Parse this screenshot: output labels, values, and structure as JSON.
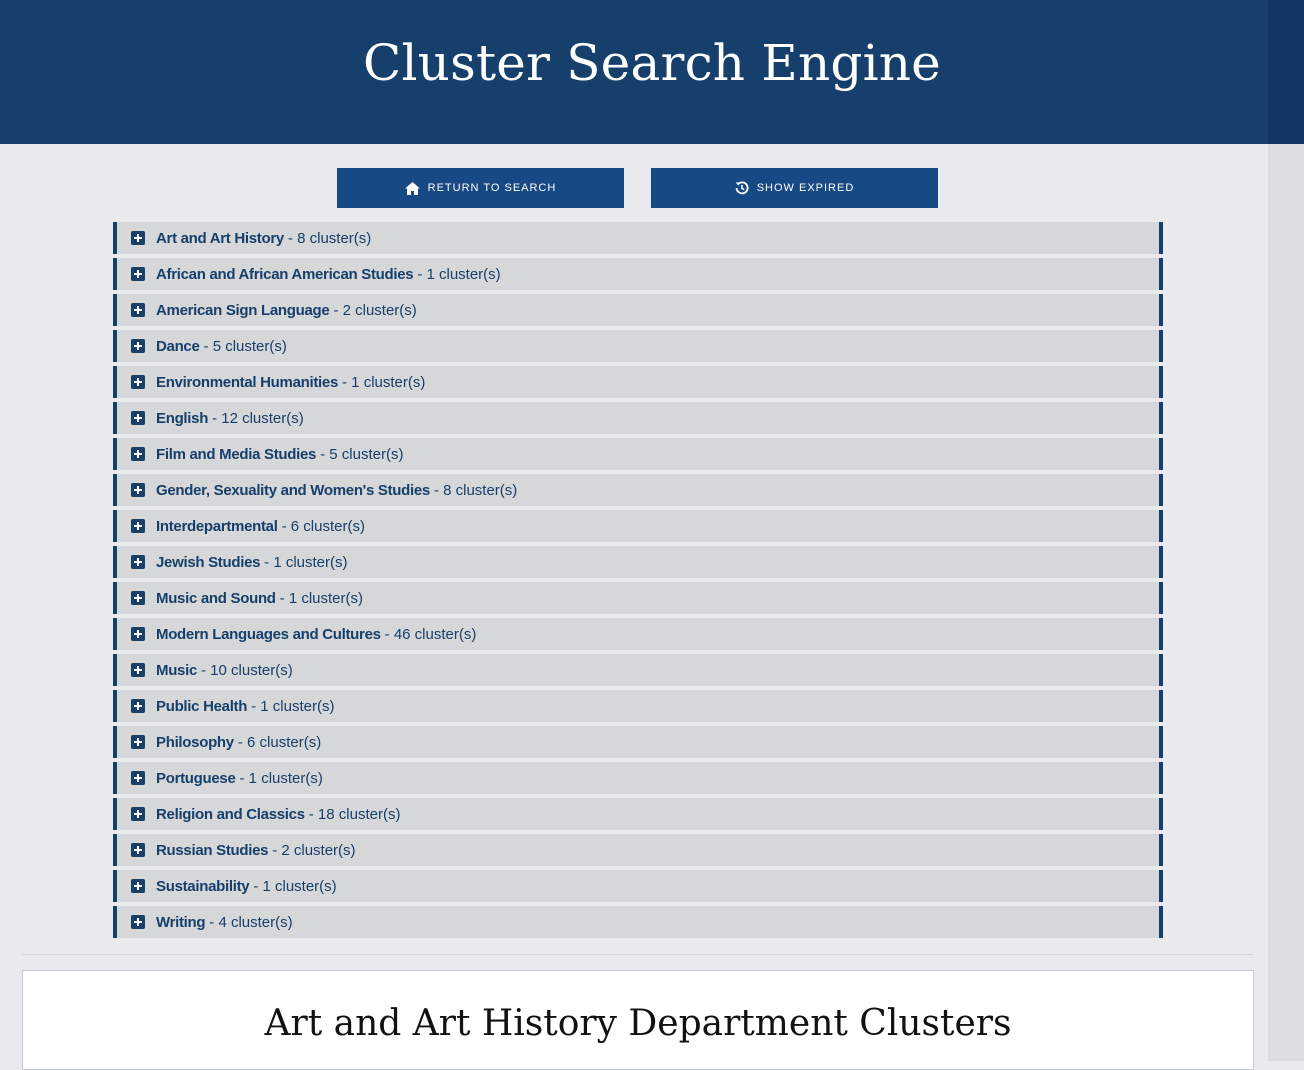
{
  "header": {
    "title": "Cluster Search Engine"
  },
  "toolbar": {
    "return_label": "Return to Search",
    "expired_label": "Show Expired"
  },
  "departments": [
    {
      "name": "Art and Art History",
      "count": "- 8 cluster(s)"
    },
    {
      "name": "African and African American Studies",
      "count": "- 1 cluster(s)"
    },
    {
      "name": "American Sign Language",
      "count": "- 2 cluster(s)"
    },
    {
      "name": "Dance",
      "count": "- 5 cluster(s)"
    },
    {
      "name": "Environmental Humanities",
      "count": "- 1 cluster(s)"
    },
    {
      "name": "English",
      "count": "- 12 cluster(s)"
    },
    {
      "name": "Film and Media Studies",
      "count": "- 5 cluster(s)"
    },
    {
      "name": "Gender, Sexuality and Women's Studies",
      "count": "- 8 cluster(s)"
    },
    {
      "name": "Interdepartmental",
      "count": "- 6 cluster(s)"
    },
    {
      "name": "Jewish Studies",
      "count": "- 1 cluster(s)"
    },
    {
      "name": "Music and Sound",
      "count": "- 1 cluster(s)"
    },
    {
      "name": "Modern Languages and Cultures",
      "count": "- 46 cluster(s)"
    },
    {
      "name": "Music",
      "count": "- 10 cluster(s)"
    },
    {
      "name": "Public Health",
      "count": "- 1 cluster(s)"
    },
    {
      "name": "Philosophy",
      "count": "- 6 cluster(s)"
    },
    {
      "name": "Portuguese",
      "count": "- 1 cluster(s)"
    },
    {
      "name": "Religion and Classics",
      "count": "- 18 cluster(s)"
    },
    {
      "name": "Russian Studies",
      "count": "- 2 cluster(s)"
    },
    {
      "name": "Sustainability",
      "count": "- 1 cluster(s)"
    },
    {
      "name": "Writing",
      "count": "- 4 cluster(s)"
    }
  ],
  "panel": {
    "title": "Art and Art History Department Clusters"
  },
  "icons": {
    "return": "home-icon",
    "expired": "history-icon",
    "expand": "plus-square-icon"
  },
  "colors": {
    "brand": "#163f6b",
    "button": "#174a85",
    "row": "#d6d7d9"
  }
}
